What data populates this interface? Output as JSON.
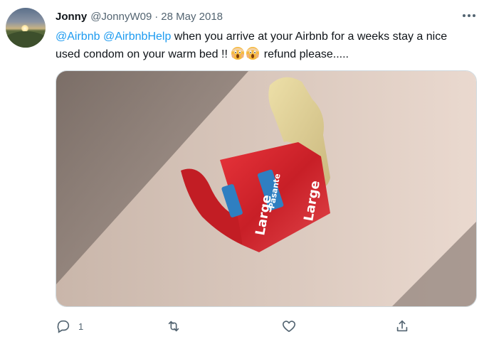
{
  "tweet": {
    "author_name": "Jonny",
    "author_handle": "@JonnyW09",
    "separator": "·",
    "date": "28 May 2018",
    "mention_1": "@Airbnb",
    "mention_2": "@AirbnbHelp",
    "text_part_1": " when you arrive at your Airbnb for a weeks stay a nice used condom on your warm bed !! ",
    "text_part_2": " refund please.....",
    "emoji": "scream-face-emoji",
    "media": {
      "wrapper_brand": "Pasante",
      "wrapper_size_label": "Large"
    }
  },
  "actions": {
    "reply_count": "1",
    "icons": [
      "reply-icon",
      "retweet-icon",
      "like-icon",
      "share-icon"
    ]
  },
  "colors": {
    "link": "#1d9bf0",
    "text": "#0f1419",
    "secondary": "#536471",
    "border": "#cfd9de",
    "wrapper_red": "#d8262e"
  }
}
